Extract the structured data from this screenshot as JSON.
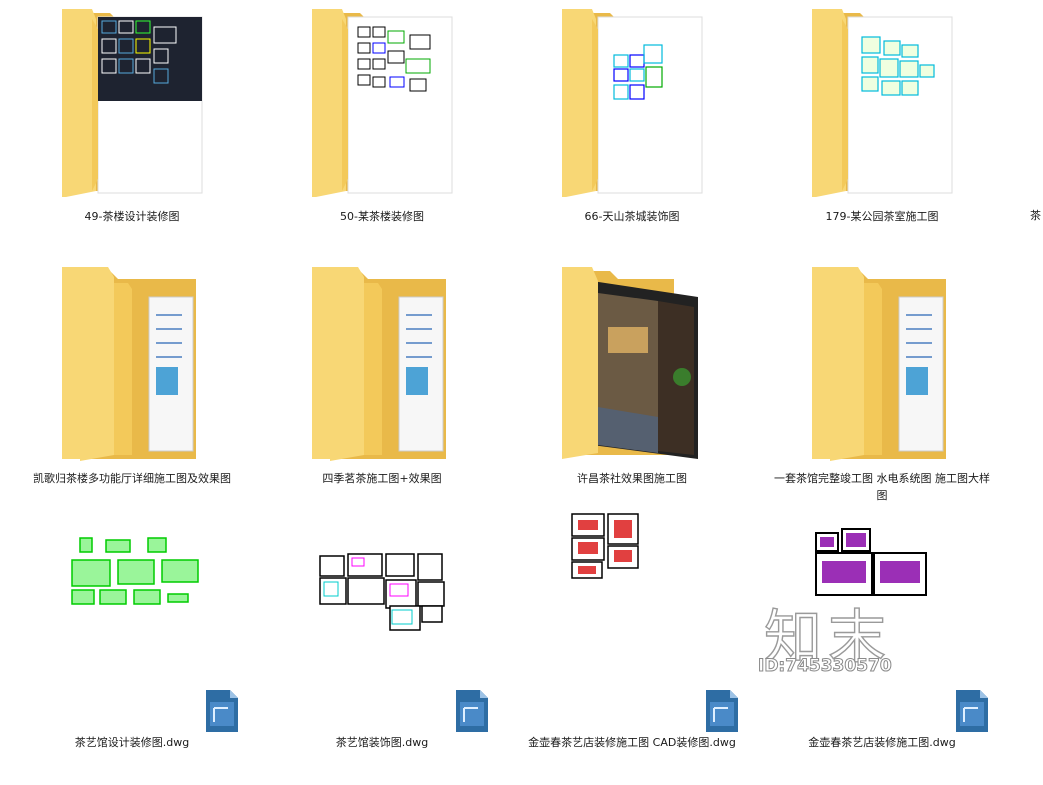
{
  "items": [
    {
      "label": "49-茶楼设计装修图",
      "type": "folder",
      "icon": "folder-cad-dark-icon"
    },
    {
      "label": "50-某茶楼装修图",
      "type": "folder",
      "icon": "folder-cad-icon"
    },
    {
      "label": "66-天山茶城装饰图",
      "type": "folder",
      "icon": "folder-cad-icon"
    },
    {
      "label": "179-某公园茶室施工图",
      "type": "folder",
      "icon": "folder-cad-icon"
    },
    {
      "label": "凯歌归茶楼多功能厅详细施工图及效果图",
      "type": "folder",
      "icon": "folder-documents-icon"
    },
    {
      "label": "四季茗茶施工图+效果图",
      "type": "folder",
      "icon": "folder-documents-icon"
    },
    {
      "label": "许昌茶社效果图施工图",
      "type": "folder",
      "icon": "folder-photo-icon"
    },
    {
      "label": "一套茶馆完整竣工图 水电系统图 施工图大样图",
      "type": "folder",
      "icon": "folder-documents-icon"
    },
    {
      "label": "",
      "type": "cad-preview",
      "icon": "cad-preview-green-icon"
    },
    {
      "label": "",
      "type": "cad-preview",
      "icon": "cad-preview-cyan-icon"
    },
    {
      "label": "",
      "type": "cad-preview",
      "icon": "cad-preview-red-icon"
    },
    {
      "label": "",
      "type": "cad-preview",
      "icon": "cad-preview-purple-icon"
    },
    {
      "label": "茶艺馆设计装修图.dwg",
      "type": "file",
      "icon": "dwg-file-icon"
    },
    {
      "label": "茶艺馆装饰图.dwg",
      "type": "file",
      "icon": "dwg-file-icon"
    },
    {
      "label": "金壶春茶艺店装修施工图 CAD装修图.dwg",
      "type": "file",
      "icon": "dwg-file-icon"
    },
    {
      "label": "金壶春茶艺店装修施工图.dwg",
      "type": "file",
      "icon": "dwg-file-icon"
    }
  ],
  "cut_off_label": "茶",
  "watermark": {
    "brand": "知末",
    "id": "ID:745330570"
  },
  "colors": {
    "folder_front": "#f8d775",
    "folder_back": "#e9b949",
    "dwg_blue": "#2e6da4"
  }
}
